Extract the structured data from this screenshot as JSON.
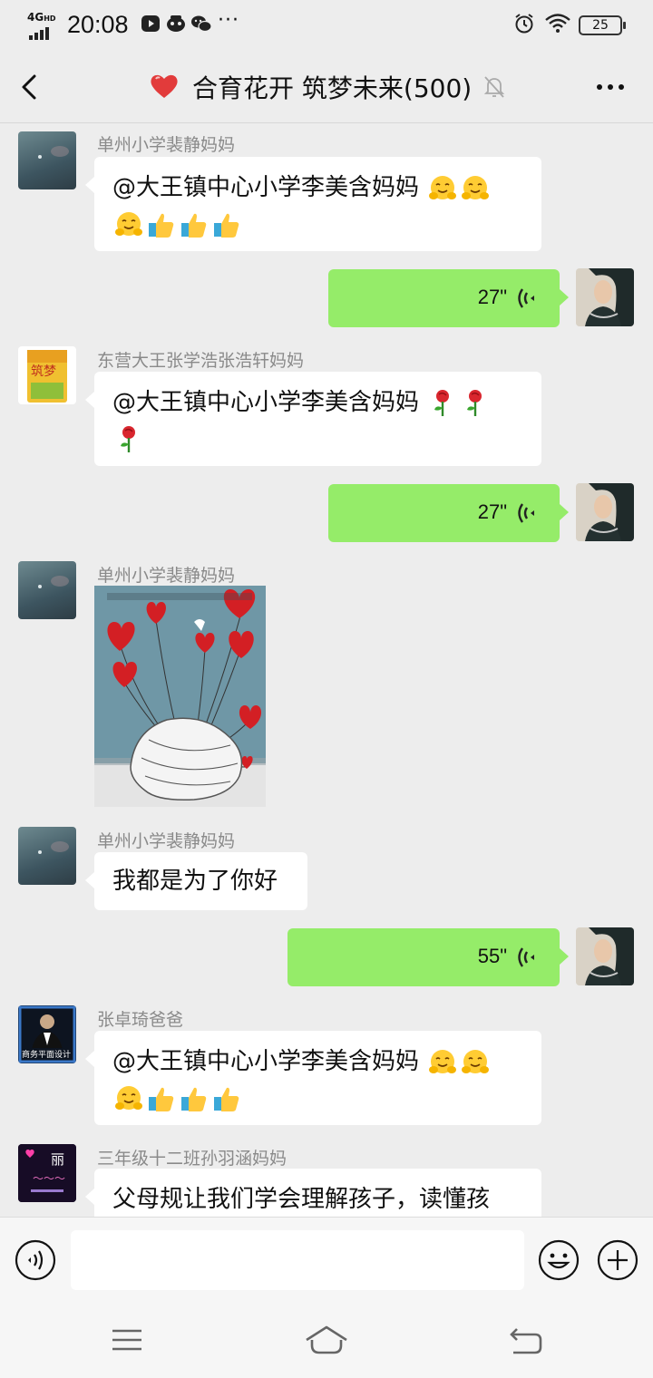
{
  "status_bar": {
    "network": "4G",
    "network_sup": "HD",
    "time": "20:08",
    "more": "···",
    "battery": "25"
  },
  "header": {
    "title": "合育花开 筑梦未来(500)"
  },
  "messages": [
    {
      "type": "incoming",
      "sender": "单州小学裴静妈妈",
      "line1": "@大王镇中心小学李美含妈妈",
      "line2": ""
    },
    {
      "type": "voice_out",
      "duration": "27\""
    },
    {
      "type": "incoming",
      "sender": "东营大王张学浩张浩轩妈妈",
      "line1": "@大王镇中心小学李美含妈妈",
      "line2": ""
    },
    {
      "type": "voice_out",
      "duration": "27\""
    },
    {
      "type": "image_in",
      "sender": "单州小学裴静妈妈"
    },
    {
      "type": "incoming",
      "sender": "单州小学裴静妈妈",
      "line1": "我都是为了你好"
    },
    {
      "type": "voice_out",
      "duration": "55\""
    },
    {
      "type": "incoming",
      "sender": "张卓琦爸爸",
      "line1": "@大王镇中心小学李美含妈妈",
      "line2": ""
    },
    {
      "type": "incoming",
      "sender": "三年级十二班孙羽涵妈妈",
      "line1": "父母规让我们学会理解孩子，读懂孩"
    }
  ],
  "avatars": {
    "zhang_badge": "商务平面设计",
    "sun_label": "丽"
  },
  "icons": {
    "hug_emoji": "hugging-face",
    "thumb_emoji": "thumbs-up",
    "rose_emoji": "rose"
  },
  "colors": {
    "bg": "#ededed",
    "out_bubble": "#95ec69",
    "in_bubble": "#ffffff"
  }
}
